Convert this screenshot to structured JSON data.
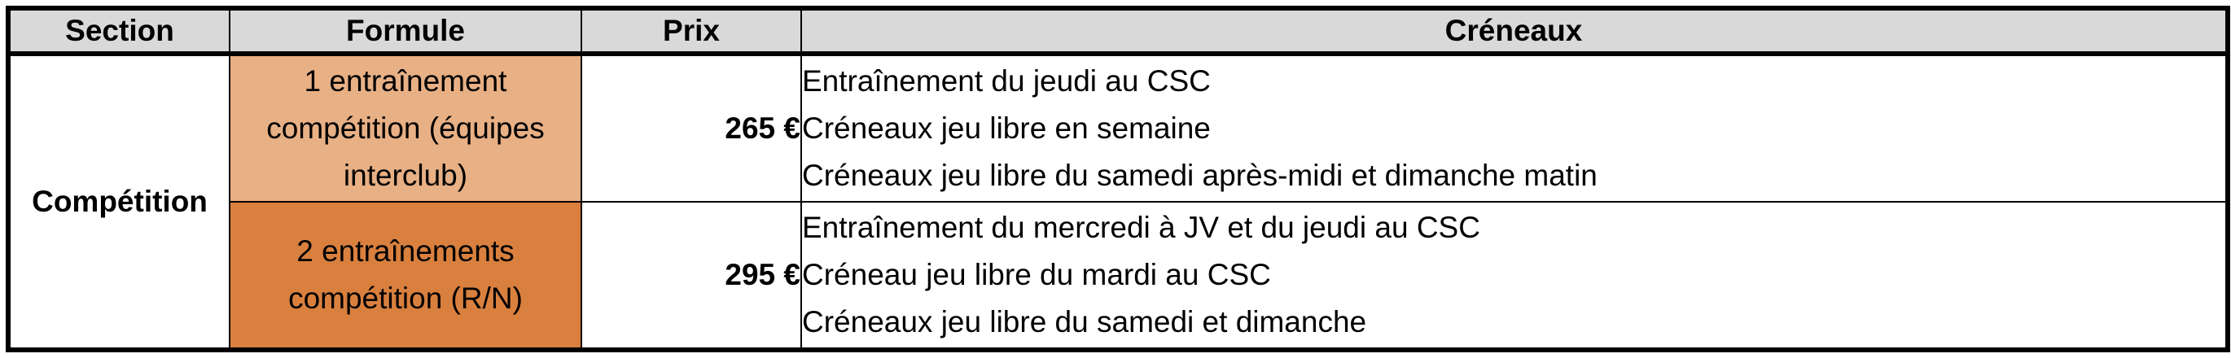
{
  "table": {
    "headers": {
      "section": "Section",
      "formule": "Formule",
      "prix": "Prix",
      "creneaux": "Créneaux"
    },
    "section_label": "Compétition",
    "rows": [
      {
        "formule": "1 entraînement compétition (équipes interclub)",
        "prix": "265 €",
        "creneaux": [
          "Entraînement du jeudi au CSC",
          "Créneaux jeu libre en semaine",
          "Créneaux jeu libre du samedi après-midi et dimanche matin"
        ]
      },
      {
        "formule": "2 entraînements compétition (R/N)",
        "prix": "295 €",
        "creneaux": [
          "Entraînement du mercredi à JV et du jeudi au CSC",
          "Créneau jeu libre du mardi au CSC",
          "Créneaux jeu libre du samedi et dimanche"
        ]
      }
    ]
  },
  "colors": {
    "header_bg": "#d9d9d9",
    "formule_row1_bg": "#e8b085",
    "formule_row2_bg": "#d9803f",
    "border": "#000000"
  }
}
